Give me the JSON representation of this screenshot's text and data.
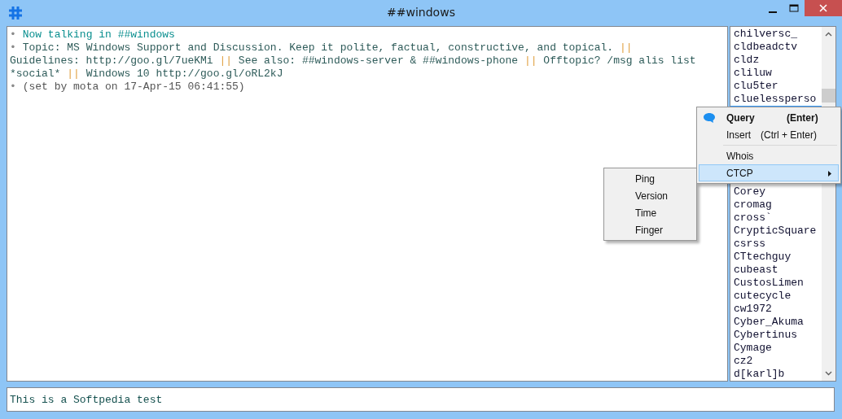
{
  "window": {
    "title": "##windows"
  },
  "chat": {
    "lines": [
      {
        "kind": "join",
        "marker": "•",
        "segments": [
          {
            "kind": "text",
            "text": "Now talking in ##windows"
          }
        ]
      },
      {
        "kind": "topic",
        "marker": "•",
        "segments": [
          {
            "kind": "text",
            "text": "Topic: MS Windows Support and Discussion. Keep it polite, factual, constructive, and topical. "
          },
          {
            "kind": "separator",
            "text": "||"
          }
        ]
      },
      {
        "kind": "topic",
        "segments": [
          {
            "kind": "text",
            "text": "Guidelines: http://goo.gl/7ueKMi "
          },
          {
            "kind": "separator",
            "text": "||"
          },
          {
            "kind": "text",
            "text": " See also: ##windows-server & ##windows-phone "
          },
          {
            "kind": "separator",
            "text": "||"
          },
          {
            "kind": "text",
            "text": " Offtopic? /msg alis list"
          }
        ]
      },
      {
        "kind": "topic",
        "segments": [
          {
            "kind": "text",
            "text": "*social* "
          },
          {
            "kind": "separator",
            "text": "||"
          },
          {
            "kind": "text",
            "text": " Windows 10 http://goo.gl/oRL2kJ"
          }
        ]
      },
      {
        "kind": "info",
        "marker": "•",
        "segments": [
          {
            "kind": "text",
            "text": "(set by mota on 17-Apr-15 06:41:55)"
          }
        ]
      }
    ]
  },
  "nicklist": {
    "above_menu": [
      "chilversc_",
      "cldbeadctv",
      "cldz",
      "cliluw",
      "clu5ter",
      "cluelessperso"
    ],
    "below_menu": [
      "Corey",
      "cromag",
      "cross`",
      "CrypticSquare",
      "csrss",
      "CTtechguy",
      "cubeast",
      "CustosLimen",
      "cutecycle",
      "cw1972",
      "Cyber_Akuma",
      "Cybertinus",
      "Cymage",
      "cz2",
      "d[karl]b"
    ]
  },
  "context_menu": {
    "items": [
      {
        "kind": "action",
        "label": "Query",
        "shortcut": "(Enter)",
        "default": true,
        "selected": false
      },
      {
        "kind": "action",
        "label": "Insert",
        "shortcut": "(Ctrl + Enter)",
        "default": false,
        "selected": false
      },
      {
        "kind": "separator"
      },
      {
        "kind": "action",
        "label": "Whois",
        "default": false,
        "selected": false
      },
      {
        "kind": "submenu",
        "label": "CTCP",
        "default": false,
        "selected": true
      }
    ]
  },
  "submenu": {
    "items": [
      {
        "label": "Ping"
      },
      {
        "label": "Version"
      },
      {
        "label": "Time"
      },
      {
        "label": "Finger"
      }
    ]
  },
  "input": {
    "value": "This is a Softpedia test"
  }
}
